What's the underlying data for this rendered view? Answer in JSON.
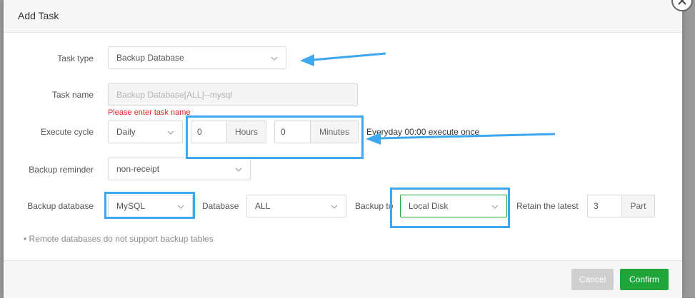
{
  "dialog": {
    "title": "Add Task"
  },
  "form": {
    "task_type": {
      "label": "Task type",
      "value": "Backup Database"
    },
    "task_name": {
      "label": "Task name",
      "value": "Backup Database[ALL]--mysql",
      "error": "Please enter task name"
    },
    "execute_cycle": {
      "label": "Execute cycle",
      "period": "Daily",
      "hours": "0",
      "hours_unit": "Hours",
      "minutes": "0",
      "minutes_unit": "Minutes",
      "description": "Everyday 00:00 execute once"
    },
    "backup_reminder": {
      "label": "Backup reminder",
      "value": "non-receipt"
    },
    "backup_database": {
      "label": "Backup database",
      "type_value": "MySQL",
      "database_label": "Database",
      "database_value": "ALL",
      "backup_to_label": "Backup to",
      "backup_to_value": "Local Disk",
      "retain_label": "Retain the latest",
      "retain_value": "3",
      "retain_unit": "Part"
    },
    "note": "Remote databases do not support backup tables"
  },
  "footer": {
    "cancel_label": "Cancel",
    "confirm_label": "Confirm"
  },
  "colors": {
    "accent_green": "#20a53a",
    "annotation_blue": "#3da7f0",
    "error_red": "#e02020"
  },
  "icons": [
    "close-icon",
    "chevron-down-icon",
    "arrow-annotation"
  ]
}
